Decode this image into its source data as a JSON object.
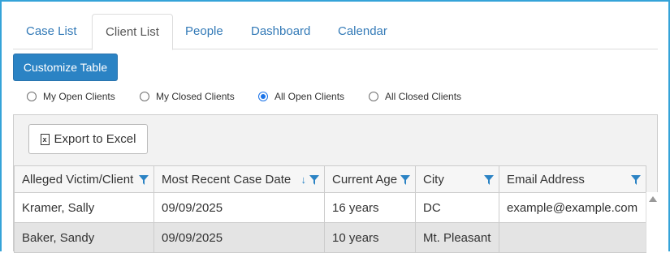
{
  "tabs": [
    {
      "label": "Case List"
    },
    {
      "label": "Client List"
    },
    {
      "label": "People"
    },
    {
      "label": "Dashboard"
    },
    {
      "label": "Calendar"
    }
  ],
  "active_tab": "Client List",
  "customize_label": "Customize Table",
  "filters": [
    {
      "label": "My Open Clients",
      "checked": false
    },
    {
      "label": "My Closed Clients",
      "checked": false
    },
    {
      "label": "All Open Clients",
      "checked": true
    },
    {
      "label": "All Closed Clients",
      "checked": false
    }
  ],
  "export_label": "Export to Excel",
  "columns": [
    "Alleged Victim/Client",
    "Most Recent Case Date",
    "Current Age",
    "City",
    "Email Address"
  ],
  "rows": [
    [
      "Kramer, Sally",
      "09/09/2025",
      "16 years",
      "DC",
      "example@example.com"
    ],
    [
      "Baker, Sandy",
      "09/09/2025",
      "10 years",
      "Mt. Pleasant",
      ""
    ]
  ],
  "colors": {
    "accent": "#2b83c4",
    "link": "#337ab7",
    "frame": "#35a3d8"
  }
}
